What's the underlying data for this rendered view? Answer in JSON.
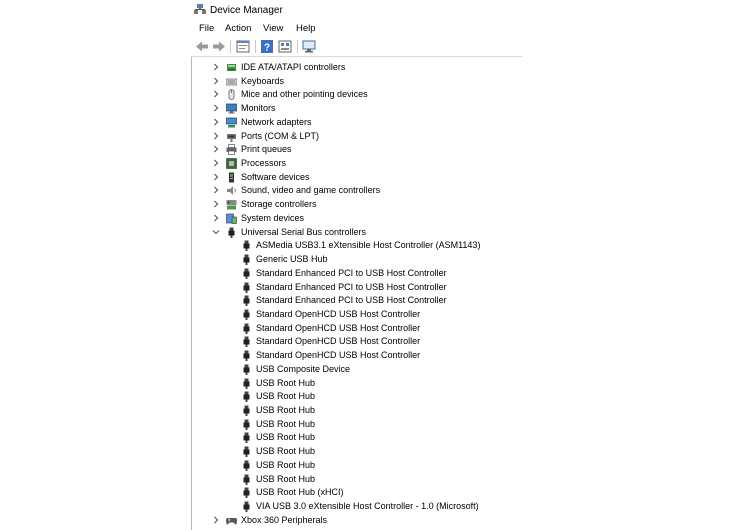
{
  "window": {
    "title": "Device Manager"
  },
  "menu": [
    "File",
    "Action",
    "View",
    "Help"
  ],
  "toolbar": [
    "back-arrow-icon",
    "forward-arrow-icon",
    "properties-icon",
    "help-icon",
    "update-driver-icon",
    "scan-hardware-icon"
  ],
  "tree": {
    "categories_before": [
      {
        "label": "IDE ATA/ATAPI controllers",
        "icon": "ide-controller-icon"
      },
      {
        "label": "Keyboards",
        "icon": "keyboard-icon"
      },
      {
        "label": "Mice and other pointing devices",
        "icon": "mouse-icon"
      },
      {
        "label": "Monitors",
        "icon": "monitor-icon"
      },
      {
        "label": "Network adapters",
        "icon": "network-adapter-icon"
      },
      {
        "label": "Ports (COM & LPT)",
        "icon": "port-icon"
      },
      {
        "label": "Print queues",
        "icon": "printer-icon"
      },
      {
        "label": "Processors",
        "icon": "processor-icon"
      },
      {
        "label": "Software devices",
        "icon": "software-device-icon"
      },
      {
        "label": "Sound, video and game controllers",
        "icon": "speaker-icon"
      },
      {
        "label": "Storage controllers",
        "icon": "storage-controller-icon"
      },
      {
        "label": "System devices",
        "icon": "system-devices-icon"
      }
    ],
    "expanded_category": {
      "label": "Universal Serial Bus controllers",
      "icon": "usb-icon"
    },
    "usb_children": [
      "ASMedia USB3.1 eXtensible Host Controller (ASM1143)",
      "Generic USB Hub",
      "Standard Enhanced PCI to USB Host Controller",
      "Standard Enhanced PCI to USB Host Controller",
      "Standard Enhanced PCI to USB Host Controller",
      "Standard OpenHCD USB Host Controller",
      "Standard OpenHCD USB Host Controller",
      "Standard OpenHCD USB Host Controller",
      "Standard OpenHCD USB Host Controller",
      "USB Composite Device",
      "USB Root Hub",
      "USB Root Hub",
      "USB Root Hub",
      "USB Root Hub",
      "USB Root Hub",
      "USB Root Hub",
      "USB Root Hub",
      "USB Root Hub",
      "USB Root Hub (xHCI)",
      "VIA USB 3.0 eXtensible Host Controller - 1.0 (Microsoft)"
    ],
    "categories_after": [
      {
        "label": "Xbox 360 Peripherals",
        "icon": "gamepad-icon"
      }
    ]
  }
}
